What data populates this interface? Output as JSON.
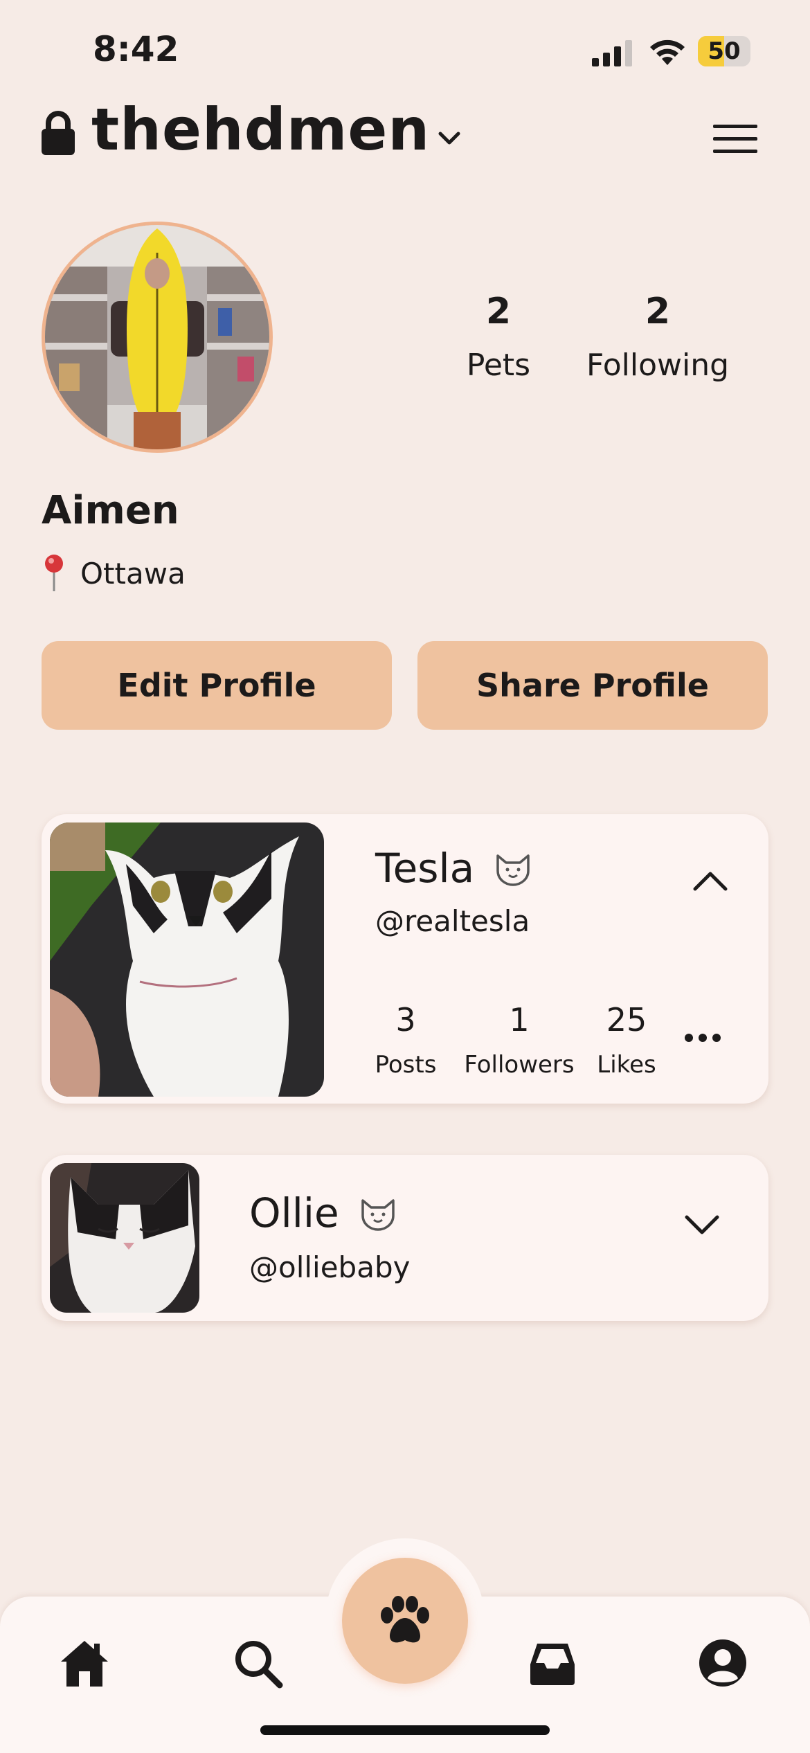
{
  "status_bar": {
    "time": "8:42",
    "battery": 50,
    "battery_label": "50"
  },
  "header": {
    "username": "thehdmen"
  },
  "profile": {
    "name": "Aimen",
    "location": "Ottawa",
    "stats": [
      {
        "value": "2",
        "label": "Pets"
      },
      {
        "value": "2",
        "label": "Following"
      }
    ],
    "edit_label": "Edit Profile",
    "share_label": "Share Profile"
  },
  "pets": [
    {
      "name": "Tesla",
      "handle": "@realtesla",
      "expanded": true,
      "stats": [
        {
          "value": "3",
          "label": "Posts"
        },
        {
          "value": "1",
          "label": "Followers"
        },
        {
          "value": "25",
          "label": "Likes"
        }
      ]
    },
    {
      "name": "Ollie",
      "handle": "@olliebaby",
      "expanded": false
    }
  ],
  "nav": [
    "home-icon",
    "search-icon",
    "paw-icon",
    "inbox-icon",
    "profile-icon"
  ],
  "colors": {
    "accent": "#efc29f",
    "background": "#f6ebe6",
    "card": "#fdf4f2"
  }
}
